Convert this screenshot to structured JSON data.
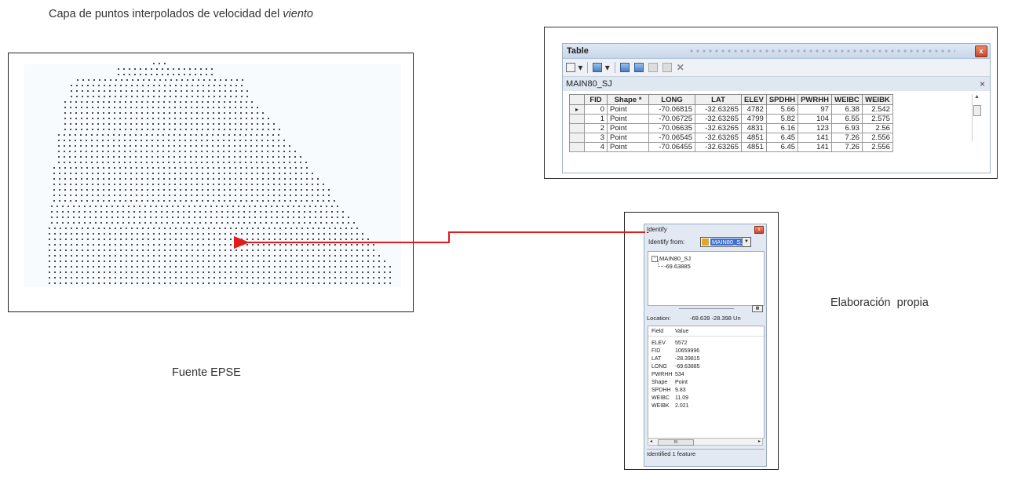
{
  "captions": {
    "top_prefix": "Capa de puntos interpolados de velocidad del ",
    "top_italic": "viento",
    "source": "Fuente EPSE",
    "own": "Elaboración  propia"
  },
  "table_window": {
    "title": "Table",
    "close": "x",
    "layer_name": "MAIN80_SJ",
    "layer_close": "×",
    "columns": [
      "FID",
      "Shape *",
      "LONG",
      "LAT",
      "ELEV",
      "SPDHH",
      "PWRHH",
      "WEIBC",
      "WEIBK"
    ],
    "rows": [
      [
        "0",
        "Point",
        "-70.06815",
        "-32.63265",
        "4782",
        "5.66",
        "97",
        "6.38",
        "2.542"
      ],
      [
        "1",
        "Point",
        "-70.06725",
        "-32.63265",
        "4799",
        "5.82",
        "104",
        "6.55",
        "2.575"
      ],
      [
        "2",
        "Point",
        "-70.06635",
        "-32.63265",
        "4831",
        "6.16",
        "123",
        "6.93",
        "2.56"
      ],
      [
        "3",
        "Point",
        "-70.06545",
        "-32.63265",
        "4851",
        "6.45",
        "141",
        "7.26",
        "2.556"
      ],
      [
        "4",
        "Point",
        "-70.06455",
        "-32.63265",
        "4851",
        "6.45",
        "141",
        "7.26",
        "2.556"
      ]
    ],
    "row_marker": "▸"
  },
  "identify_window": {
    "title_first": "I",
    "title_rest": "dentify",
    "close": "x",
    "from_label": "Identify from:",
    "from_value": "MAIN80_SJ",
    "tree_layer": "MAIN80_SJ",
    "tree_value": "-69.63885",
    "location_label": "Location:",
    "location_value": "-69.639  -28.398 Un",
    "field_header": "Field",
    "value_header": "Value",
    "fields": [
      [
        "ELEV",
        "5572"
      ],
      [
        "FID",
        "10659996"
      ],
      [
        "LAT",
        "-28.39815"
      ],
      [
        "LONG",
        "-69.63885"
      ],
      [
        "PWRHH",
        "534"
      ],
      [
        "Shape",
        "Point"
      ],
      [
        "SPDHH",
        "9.83"
      ],
      [
        "WEIBC",
        "11.09"
      ],
      [
        "WEIBK",
        "2.021"
      ]
    ],
    "scroll_thumb": "III",
    "status": "Identified 1 feature"
  },
  "colors": {
    "arrow": "#e31b1b",
    "map_bg": "#f7fbfd",
    "point": "#1a1a1a"
  }
}
